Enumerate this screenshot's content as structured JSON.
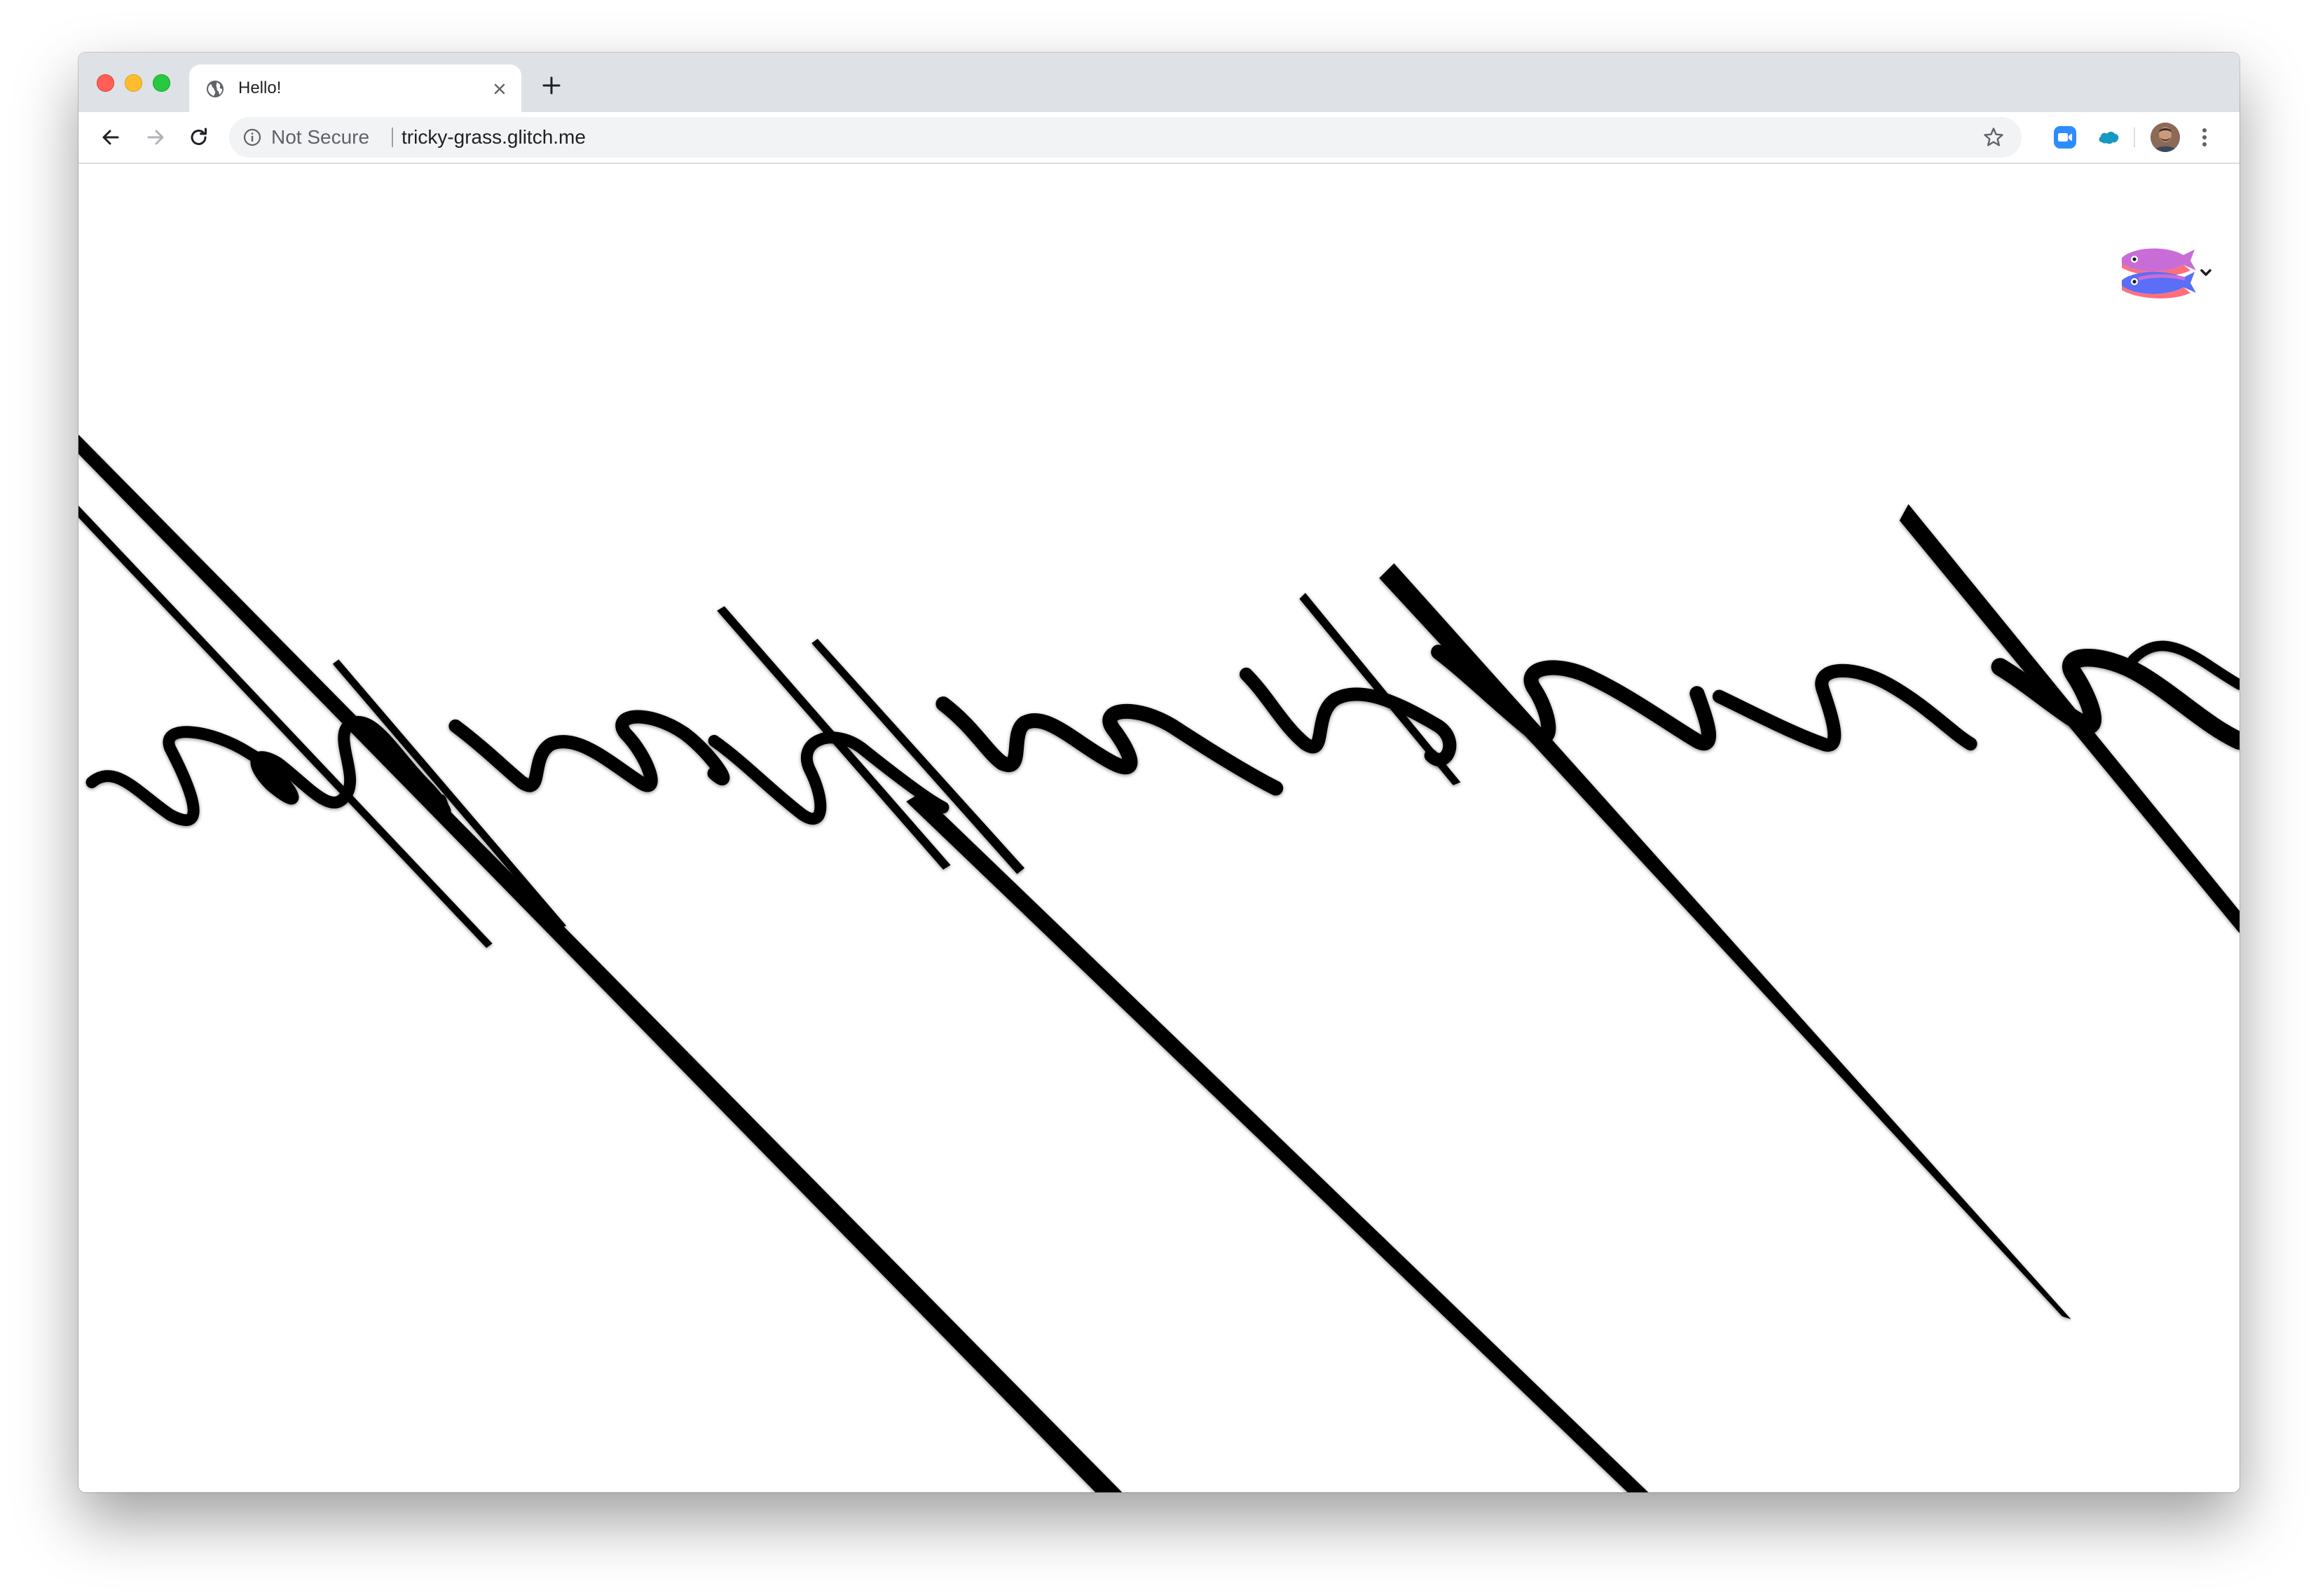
{
  "browser": {
    "tab": {
      "title": "Hello!",
      "favicon": "globe-icon"
    },
    "new_tab_icon": "plus-icon",
    "nav": {
      "back_icon": "arrow-left-icon",
      "forward_icon": "arrow-right-icon",
      "reload_icon": "reload-icon"
    },
    "address_bar": {
      "security_icon": "info-icon",
      "security_label": "Not Secure",
      "url": "tricky-grass.glitch.me",
      "bookmark_icon": "star-icon"
    },
    "extensions": [
      {
        "name": "zoom-extension-icon"
      },
      {
        "name": "salesforce-extension-icon"
      }
    ],
    "profile_icon": "avatar",
    "menu_icon": "kebab-menu-icon"
  },
  "page": {
    "artwork": "black-wave-strokes",
    "glitch_menu_icon": "glitch-fish-icon",
    "colors": {
      "stroke": "#000000",
      "background": "#ffffff",
      "fish_top": "#c86dd7",
      "fish_bottom": "#ff6f7a",
      "fish_band": "#5a6ef7"
    }
  }
}
